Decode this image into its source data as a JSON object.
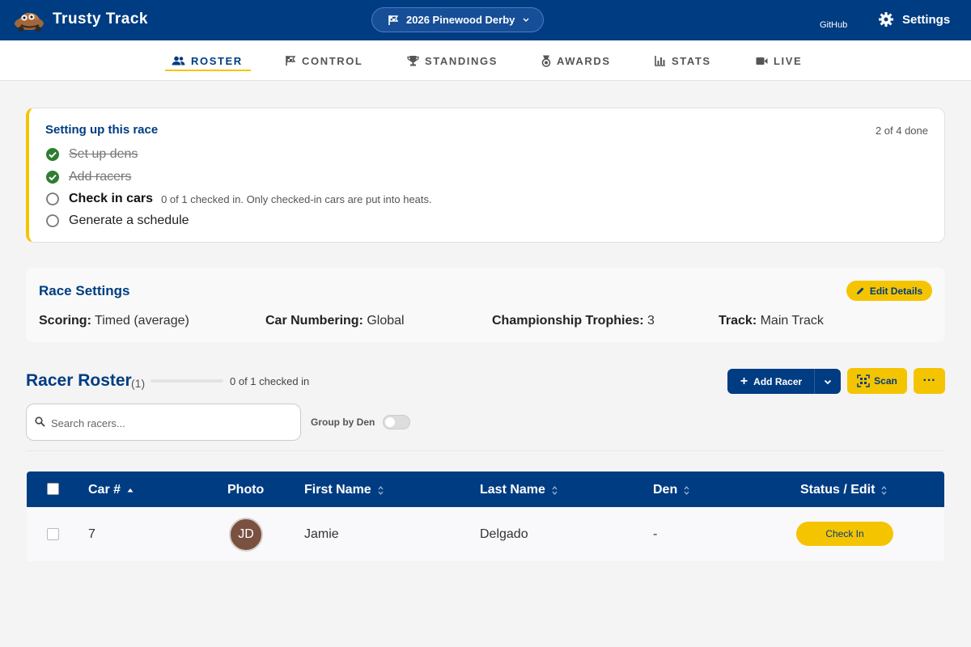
{
  "header": {
    "app_title": "Trusty Track",
    "race_selector": "2026 Pinewood Derby",
    "github_label": "GitHub",
    "settings_label": "Settings"
  },
  "tabs": [
    {
      "label": "ROSTER",
      "icon": "group-icon",
      "active": true
    },
    {
      "label": "CONTROL",
      "icon": "flag-icon",
      "active": false
    },
    {
      "label": "STANDINGS",
      "icon": "trophy-icon",
      "active": false
    },
    {
      "label": "AWARDS",
      "icon": "medal-icon",
      "active": false
    },
    {
      "label": "STATS",
      "icon": "bar-chart-icon",
      "active": false
    },
    {
      "label": "LIVE",
      "icon": "video-icon",
      "active": false
    }
  ],
  "setup": {
    "title": "Setting up this race",
    "progress": "2 of 4 done",
    "steps": [
      {
        "label": "Set up dens",
        "done": true,
        "hint": ""
      },
      {
        "label": "Add racers",
        "done": true,
        "hint": ""
      },
      {
        "label": "Check in cars",
        "done": false,
        "hint": "0 of 1 checked in. Only checked-in cars are put into heats."
      },
      {
        "label": "Generate a schedule",
        "done": false,
        "hint": ""
      }
    ]
  },
  "race_settings": {
    "title": "Race Settings",
    "edit_label": "Edit Details",
    "items": [
      {
        "key": "Scoring:",
        "value": "Timed (average)"
      },
      {
        "key": "Car Numbering:",
        "value": "Global"
      },
      {
        "key": "Championship Trophies:",
        "value": "3"
      },
      {
        "key": "Track:",
        "value": "Main Track"
      }
    ]
  },
  "roster": {
    "title": "Racer Roster",
    "count": "(1)",
    "checked_in_fraction": 0,
    "checked_in_text": "0 of 1 checked in",
    "add_racer_label": "Add Racer",
    "scan_label": "Scan",
    "more_label": "···",
    "search_placeholder": "Search racers...",
    "group_by_label": "Group by Den",
    "group_by_enabled": false
  },
  "table": {
    "columns": [
      "Car #",
      "Photo",
      "First Name",
      "Last Name",
      "Den",
      "Status / Edit"
    ],
    "rows": [
      {
        "car": "7",
        "initials": "JD",
        "first": "Jamie",
        "last": "Delgado",
        "den": "-",
        "action": "Check In"
      }
    ]
  },
  "colors": {
    "primary": "#003c82",
    "accent": "#f5c400",
    "done_check": "#2e7d32"
  }
}
